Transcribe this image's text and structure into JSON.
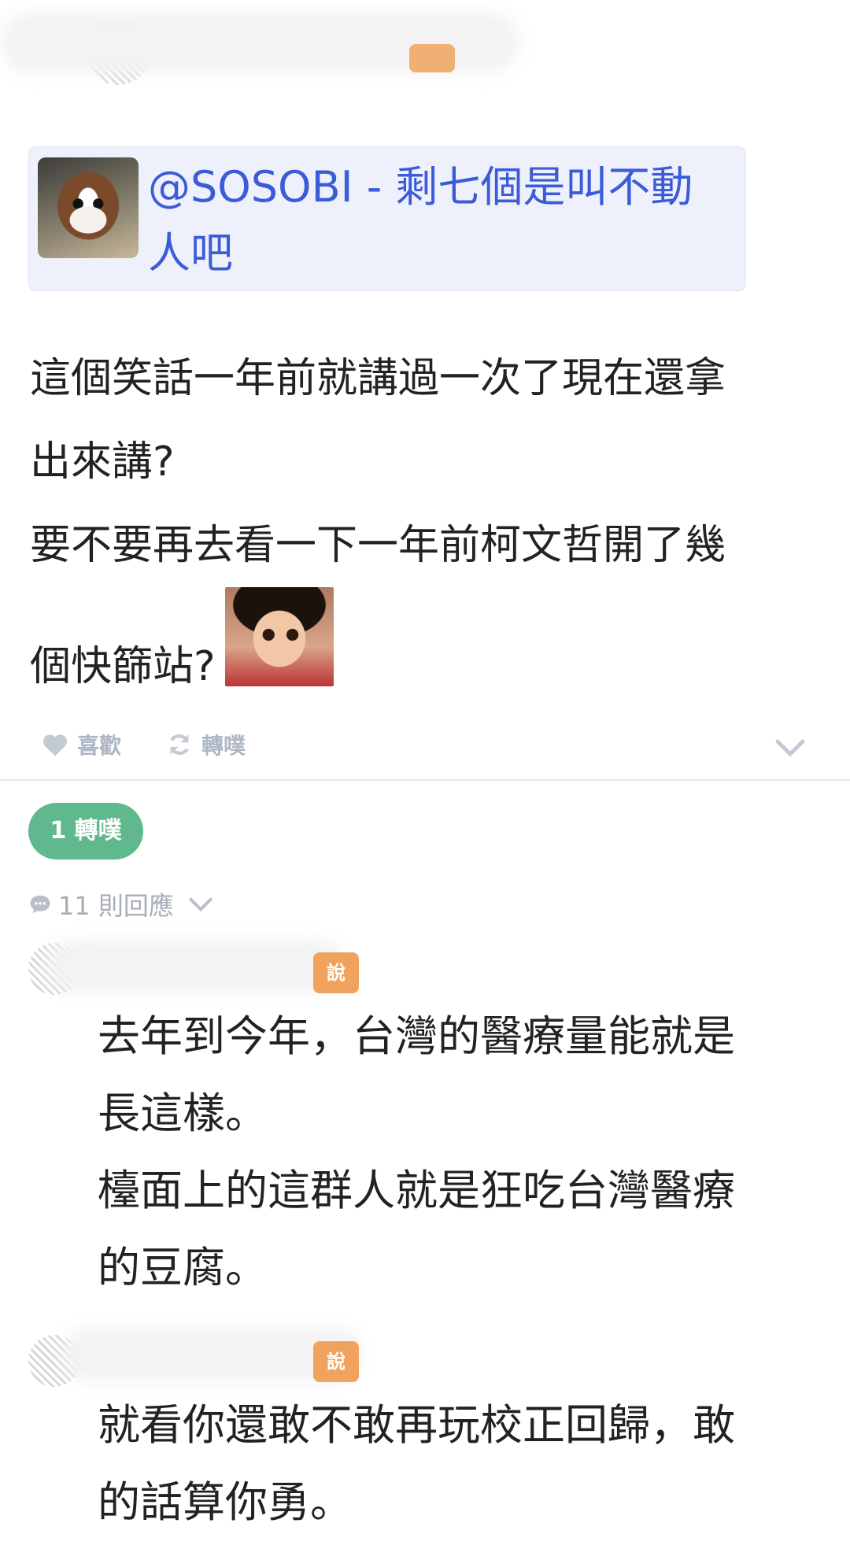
{
  "quoted_plurk": {
    "text": "@SOSOBI - 剩七個是叫不動人吧"
  },
  "post": {
    "lines": [
      "這個笑話一年前就講過一次了現在還拿",
      "出來講?",
      "要不要再去看一下一年前柯文哲開了幾",
      "個快篩站?"
    ]
  },
  "actions": {
    "like_label": "喜歡",
    "replurk_label": "轉噗"
  },
  "replurk_badge": "1 轉噗",
  "responses": {
    "count_label": "11 則回應",
    "items": [
      {
        "badge": "說",
        "text": [
          "去年到今年，台灣的醫療量能就是",
          "長這樣。",
          "檯面上的這群人就是狂吃台灣醫療",
          "的豆腐。"
        ]
      },
      {
        "badge": "說",
        "text": [
          "就看你還敢不敢再玩校正回歸，敢",
          "的話算你勇。"
        ]
      }
    ]
  },
  "colors": {
    "link": "#3b5bd8",
    "replurk_green": "#5fb88e",
    "badge_orange": "#f0a35c",
    "muted": "#aeb6c4"
  }
}
